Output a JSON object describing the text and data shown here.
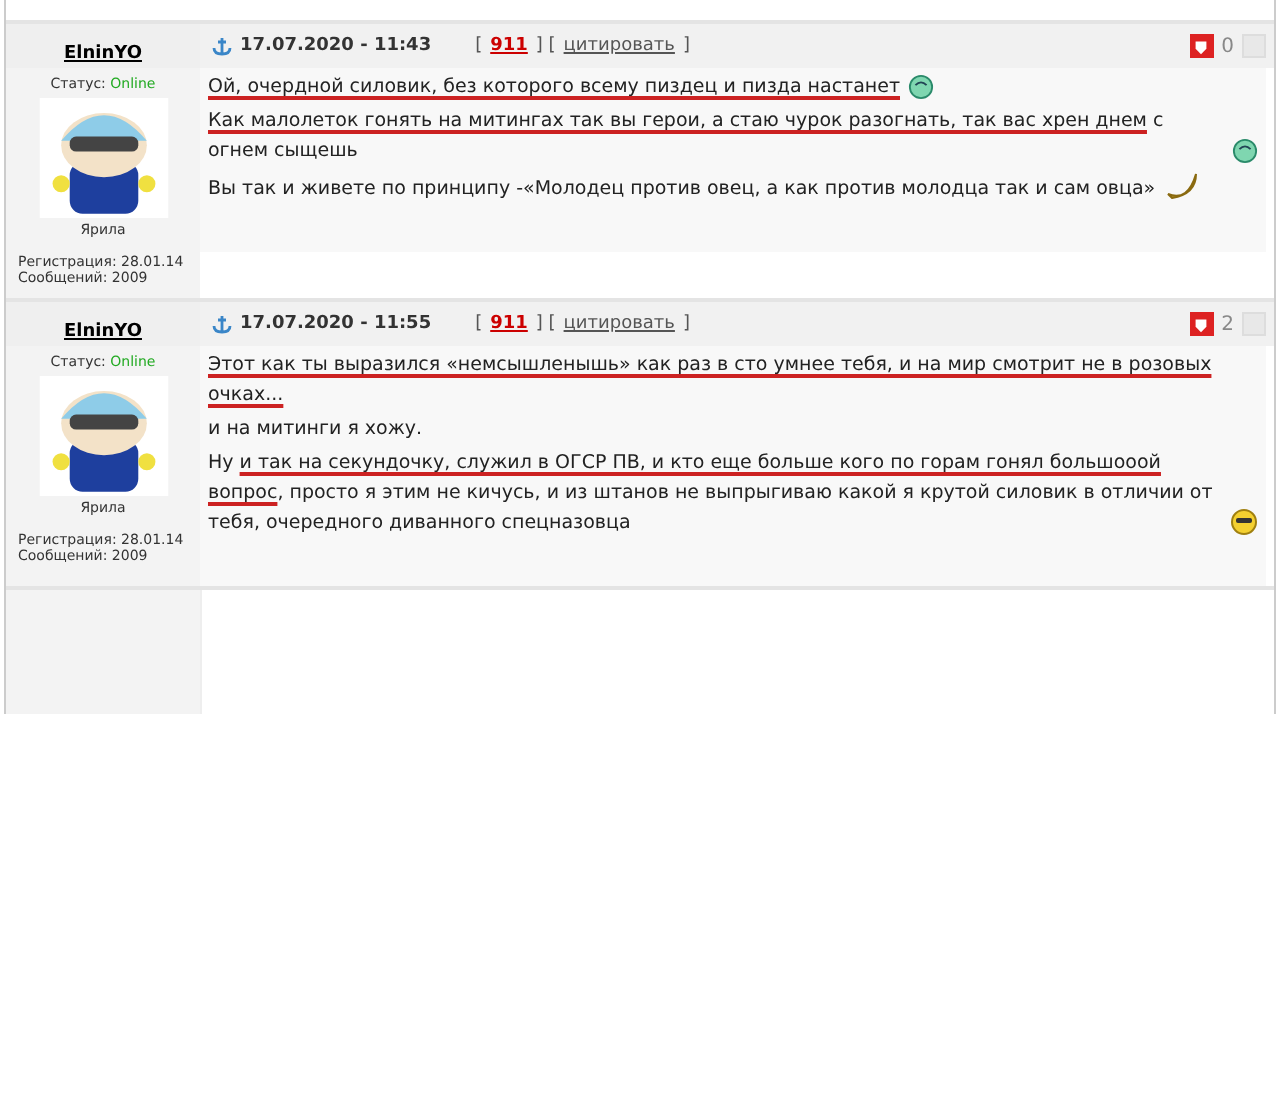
{
  "header_brackets": {
    "open": "[",
    "middle": "] [",
    "close": "]"
  },
  "posts": [
    {
      "author": "ElninYO",
      "date": "17.07.2020 - 11:43",
      "post_number": "911",
      "quote_link": "цитировать",
      "rating": "0",
      "status_label": "Статус:",
      "status": "Online",
      "rank": "Ярила",
      "registration": "Регистрация: 28.01.14",
      "messages": "Сообщений: 2009",
      "paragraphs": [
        {
          "segments": [
            {
              "text": "Ой, очердной силовик, без которого всему пиздец и пизда настанет",
              "underlined": true
            }
          ],
          "kind": "grin"
        },
        {
          "segments": [
            {
              "text": "Как малолеток гонять на митингах так вы герои, а стаю чурок разогнать, так вас хрен днем",
              "underlined": true
            },
            {
              "text": " с огнем сыщешь",
              "underlined": false
            }
          ],
          "kind": "grin"
        },
        {
          "segments": [
            {
              "text": "Вы так и живете по принципу -«Молодец против овец, а как против молодца так и сам овца»",
              "underlined": false
            }
          ],
          "kind": "banana"
        }
      ]
    },
    {
      "author": "ElninYO",
      "date": "17.07.2020 - 11:55",
      "post_number": "911",
      "quote_link": "цитировать",
      "rating": "2",
      "status_label": "Статус:",
      "status": "Online",
      "rank": "Ярила",
      "registration": "Регистрация: 28.01.14",
      "messages": "Сообщений: 2009",
      "paragraphs": [
        {
          "segments": [
            {
              "text": "Этот как ты выразился «немсышленышь» как раз в сто умнее тебя, и на мир смотрит не в розовых очках...",
              "underlined": true
            }
          ]
        },
        {
          "segments": [
            {
              "text": "и на митинги я хожу.",
              "underlined": false
            }
          ]
        },
        {
          "segments": [
            {
              "text": "Ну ",
              "underlined": false
            },
            {
              "text": "и так на секундочку, служил в ОГСР ПВ, и кто еще больше кого по горам гонял большооой вопрос",
              "underlined": true
            },
            {
              "text": ", просто я этим не кичусь, и из штанов не выпрыгиваю какой я крутой силовик в отличии от тебя, очередного диванного спецназовца",
              "underlined": false
            }
          ],
          "kind": "cool"
        }
      ]
    }
  ]
}
